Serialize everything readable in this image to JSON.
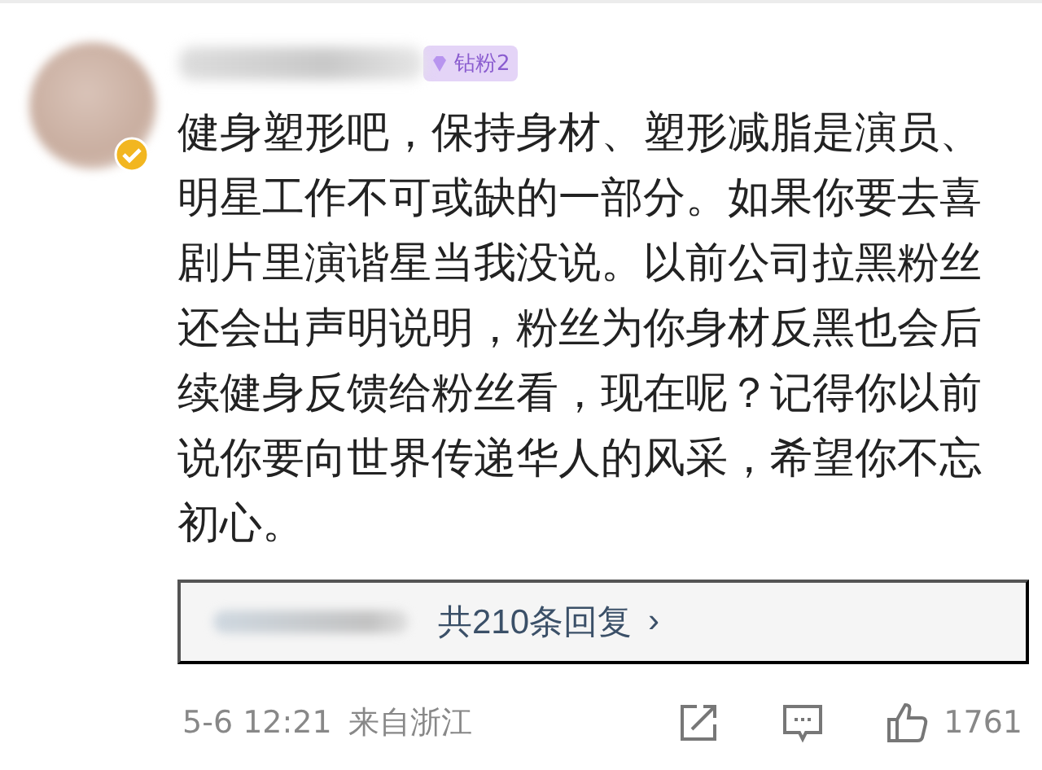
{
  "comment": {
    "badge": "钻粉2",
    "verified": true,
    "text": "健身塑形吧，保持身材、塑形减脂是演员、明星工作不可或缺的一部分。如果你要去喜剧片里演谐星当我没说。以前公司拉黑粉丝还会出声明说明，粉丝为你身材反黑也会后续健身反馈给粉丝看，现在呢？记得你以前说你要向世界传递华人的风采，希望你不忘初心。",
    "replies": {
      "label": "共210条回复",
      "chevron": "›"
    },
    "time": "5-6 12:21",
    "location": "来自浙江",
    "likes": "1761"
  }
}
